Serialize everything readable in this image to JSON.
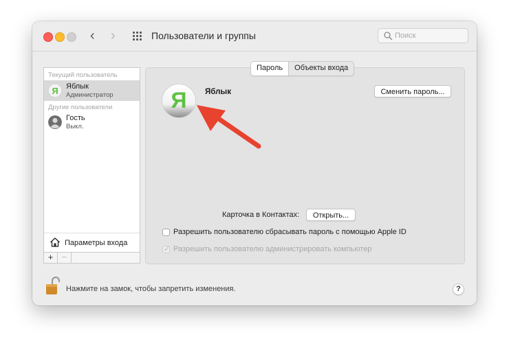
{
  "window": {
    "title": "Пользователи и группы"
  },
  "search": {
    "placeholder": "Поиск",
    "value": ""
  },
  "sidebar": {
    "current_header": "Текущий пользователь",
    "current_user": {
      "name": "Яблык",
      "role": "Администратор",
      "avatar_letter": "Я"
    },
    "other_header": "Другие пользователи",
    "other_users": [
      {
        "name": "Гость",
        "role": "Выкл."
      }
    ],
    "login_options_label": "Параметры входа",
    "add_label": "+",
    "remove_label": "−"
  },
  "tabs": [
    {
      "label": "Пароль",
      "active": true
    },
    {
      "label": "Объекты входа",
      "active": false
    }
  ],
  "account": {
    "name": "Яблык",
    "avatar_letter": "Я",
    "change_password_label": "Сменить пароль...",
    "contacts_card_label": "Карточка в Контактах:",
    "open_label": "Открыть...",
    "checkbox_reset": {
      "label": "Разрешить пользователю сбрасывать пароль с помощью Apple ID",
      "checked": false
    },
    "checkbox_admin": {
      "label": "Разрешить пользователю администрировать компьютер",
      "checked": true,
      "disabled": true
    }
  },
  "footer": {
    "lock_text": "Нажмите на замок, чтобы запретить изменения.",
    "help_label": "?"
  },
  "colors": {
    "accent_arrow": "#e8432f",
    "avatar_green": "#5ec043",
    "traffic_red": "#fe5f57",
    "traffic_yellow": "#febc2e"
  }
}
